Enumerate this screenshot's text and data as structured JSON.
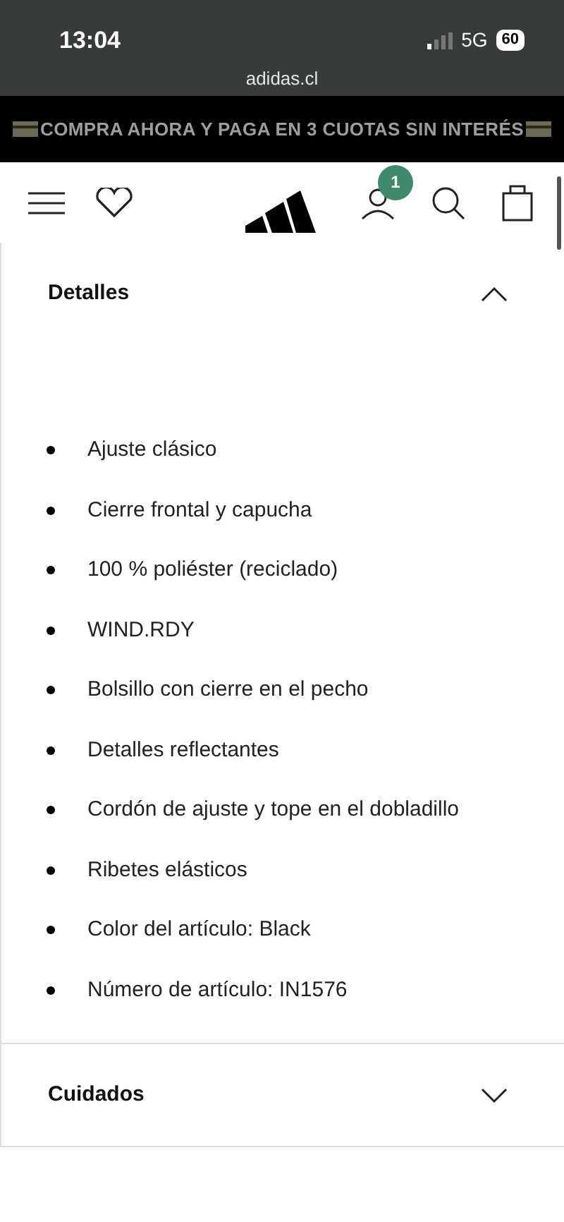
{
  "status_bar": {
    "time": "13:04",
    "network": "5G",
    "battery": "60"
  },
  "browser": {
    "url": "adidas.cl"
  },
  "promo_banner": {
    "text": "COMPRA AHORA Y PAGA EN 3 CUOTAS SIN INTERÉS"
  },
  "header": {
    "account_badge": "1"
  },
  "sections": [
    {
      "title": "Detalles",
      "expanded": true,
      "items": [
        "Ajuste clásico",
        "Cierre frontal y capucha",
        "100 % poliéster (reciclado)",
        "WIND.RDY",
        "Bolsillo con cierre en el pecho",
        "Detalles reflectantes",
        "Cordón de ajuste y tope en el dobladillo",
        "Ribetes elásticos",
        "Color del artículo: Black",
        "Número de artículo: IN1576"
      ]
    },
    {
      "title": "Cuidados",
      "expanded": false
    }
  ]
}
